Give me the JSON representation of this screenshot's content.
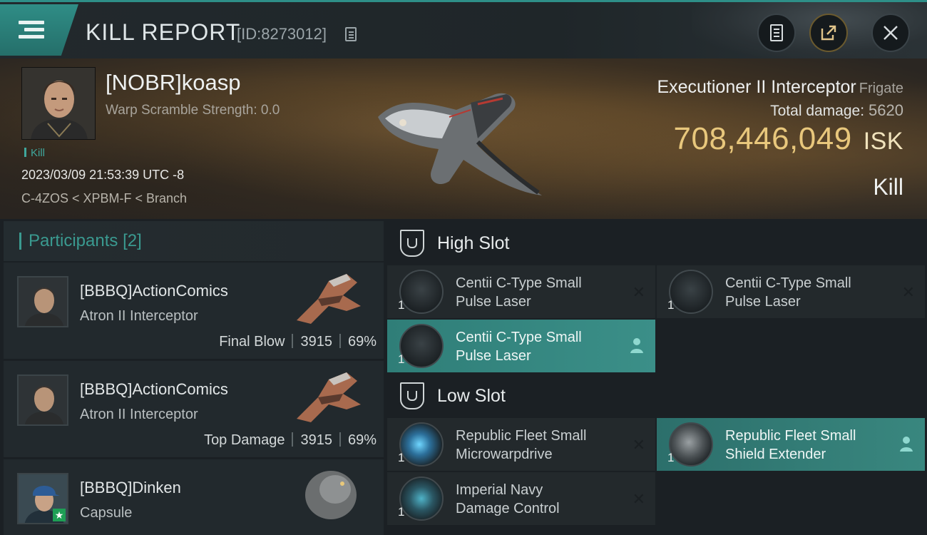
{
  "header": {
    "title": "KILL REPORT",
    "report_id": "[ID:8273012]"
  },
  "victim": {
    "name": "[NOBR]koasp",
    "warp_scramble": "Warp Scramble Strength: 0.0",
    "tag": "Kill",
    "datetime": "2023/03/09 21:53:39 UTC -8",
    "location": "C-4ZOS < XPBM-F < Branch",
    "ship_name": "Executioner II Interceptor",
    "ship_class": "Frigate",
    "total_damage_label": "Total damage:",
    "total_damage": "5620",
    "isk_value": "708,446,049",
    "isk_unit": "ISK",
    "outcome": "Kill"
  },
  "participants": {
    "title": "Participants",
    "count": "[2]",
    "rows": [
      {
        "name": "[BBBQ]ActionComics",
        "ship": "Atron II Interceptor",
        "role": "Final Blow",
        "damage": "3915",
        "percent": "69%"
      },
      {
        "name": "[BBBQ]ActionComics",
        "ship": "Atron II Interceptor",
        "role": "Top Damage",
        "damage": "3915",
        "percent": "69%"
      },
      {
        "name": "[BBBQ]Dinken",
        "ship": "Capsule"
      }
    ]
  },
  "fitting": {
    "high_slot_label": "High Slot",
    "low_slot_label": "Low Slot",
    "high": [
      {
        "qty": "1",
        "name_line1": "Centii C-Type Small",
        "name_line2": "Pulse Laser",
        "state": "destroyed"
      },
      {
        "qty": "1",
        "name_line1": "Centii C-Type Small",
        "name_line2": "Pulse Laser",
        "state": "destroyed"
      },
      {
        "qty": "1",
        "name_line1": "Centii C-Type Small",
        "name_line2": "Pulse Laser",
        "state": "dropped"
      }
    ],
    "low": [
      {
        "qty": "1",
        "name_line1": "Republic Fleet Small",
        "name_line2": "Microwarpdrive",
        "state": "destroyed"
      },
      {
        "qty": "1",
        "name_line1": "Republic Fleet Small",
        "name_line2": "Shield Extender",
        "state": "dropped"
      },
      {
        "qty": "1",
        "name_line1": "Imperial Navy",
        "name_line2": "Damage Control",
        "state": "destroyed"
      }
    ]
  },
  "colors": {
    "accent_teal": "#2f8d86",
    "isk_gold": "#e8c77c"
  },
  "icons": [
    "menu-icon",
    "copy-icon",
    "notes-icon",
    "share-icon",
    "close-icon",
    "slot-shield-icon",
    "pilot-icon"
  ]
}
